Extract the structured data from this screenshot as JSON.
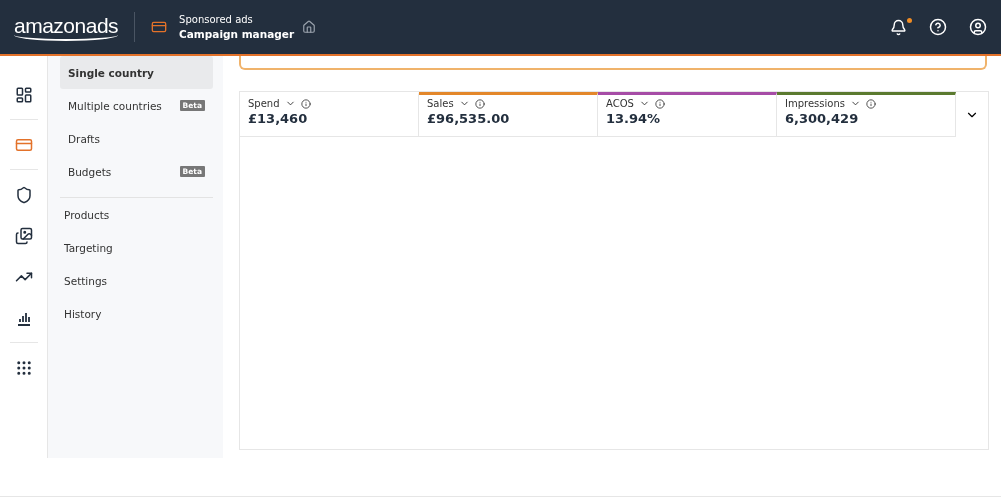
{
  "header": {
    "logo": "amazonads",
    "product_line": "Sponsored ads",
    "product": "Campaign manager",
    "notifications_unread": true
  },
  "rail": [
    {
      "kind": "overview",
      "selected": false
    },
    {
      "kind": "campaigns",
      "selected": true
    },
    {
      "kind": "brand",
      "selected": false
    },
    {
      "kind": "media",
      "selected": false
    },
    {
      "kind": "trends",
      "selected": false
    },
    {
      "kind": "reports",
      "selected": false
    },
    {
      "kind": "apps",
      "selected": false
    }
  ],
  "nav": {
    "items": [
      {
        "label": "Single country",
        "selected": true
      },
      {
        "label": "Multiple countries",
        "badge": "Beta",
        "selected": false
      },
      {
        "label": "Drafts",
        "selected": false
      },
      {
        "label": "Budgets",
        "badge": "Beta",
        "selected": false
      }
    ],
    "sub_items": [
      {
        "label": "Products",
        "selected": false
      },
      {
        "label": "Targeting",
        "selected": false
      },
      {
        "label": "Settings",
        "selected": false
      },
      {
        "label": "History",
        "selected": false
      }
    ]
  },
  "metrics": [
    {
      "label": "Spend",
      "value": "£13,460"
    },
    {
      "label": "Sales",
      "value": "£96,535.00",
      "color": "#e3872a"
    },
    {
      "label": "ACOS",
      "value": "13.94%",
      "color": "#a64ca6"
    },
    {
      "label": "Impressions",
      "value": "6,300,429",
      "color": "#5b7a2f"
    }
  ]
}
